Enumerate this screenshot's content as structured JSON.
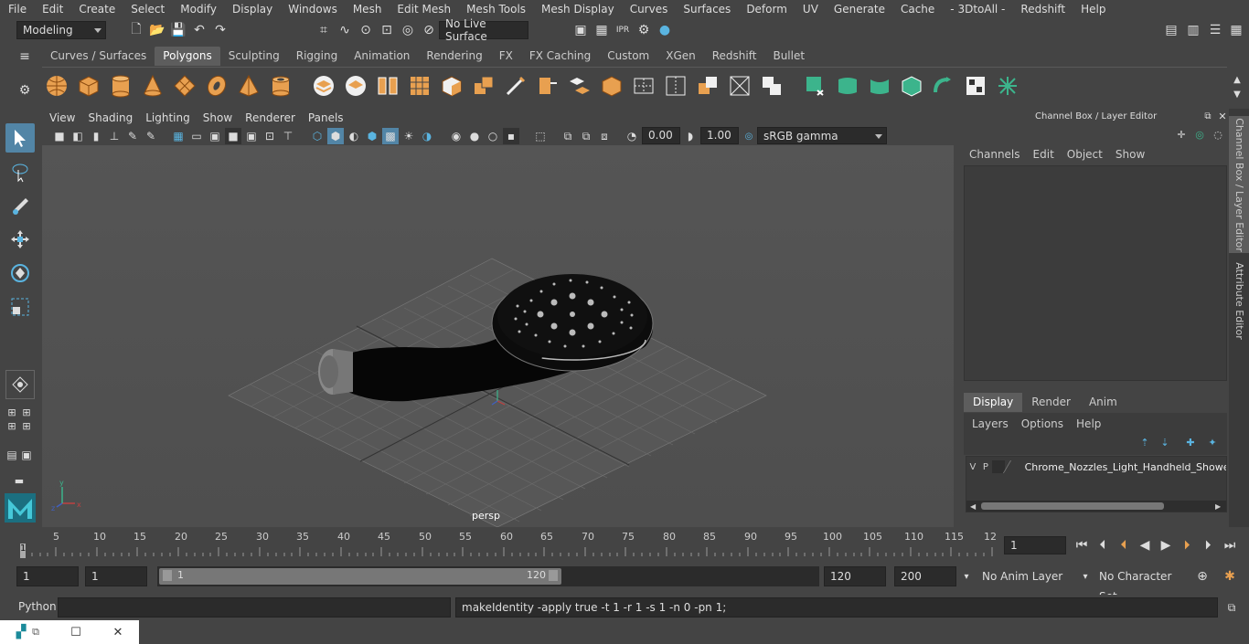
{
  "menubar": [
    "File",
    "Edit",
    "Create",
    "Select",
    "Modify",
    "Display",
    "Windows",
    "Mesh",
    "Edit Mesh",
    "Mesh Tools",
    "Mesh Display",
    "Curves",
    "Surfaces",
    "Deform",
    "UV",
    "Generate",
    "Cache",
    "- 3DtoAll -",
    "Redshift",
    "Help"
  ],
  "mode_dropdown": "Modeling",
  "live_surface": "No Live Surface",
  "shelf_tabs": [
    "Curves / Surfaces",
    "Polygons",
    "Sculpting",
    "Rigging",
    "Animation",
    "Rendering",
    "FX",
    "FX Caching",
    "Custom",
    "XGen",
    "Redshift",
    "Bullet"
  ],
  "shelf_active": "Polygons",
  "panel_menu": [
    "View",
    "Shading",
    "Lighting",
    "Show",
    "Renderer",
    "Panels"
  ],
  "panel_fields": {
    "exposure": "0.00",
    "gamma": "1.00",
    "colorspace": "sRGB gamma"
  },
  "viewport": {
    "camera_label": "persp"
  },
  "channel_box": {
    "title": "Channel Box / Layer Editor",
    "menu": [
      "Channels",
      "Edit",
      "Object",
      "Show"
    ]
  },
  "layer_tabs": [
    "Display",
    "Render",
    "Anim"
  ],
  "layer_active": "Display",
  "layer_menu": [
    "Layers",
    "Options",
    "Help"
  ],
  "layer_row": {
    "v": "V",
    "p": "P",
    "name": "Chrome_Nozzles_Light_Handheld_Shower_H"
  },
  "side_tabs": [
    "Channel Box / Layer Editor",
    "Attribute Editor"
  ],
  "timeline": {
    "ticks": [
      "5",
      "10",
      "15",
      "20",
      "25",
      "30",
      "35",
      "40",
      "45",
      "50",
      "55",
      "60",
      "65",
      "70",
      "75",
      "80",
      "85",
      "90",
      "95",
      "100",
      "105",
      "110",
      "115",
      "12"
    ],
    "start": "1",
    "current": "1"
  },
  "range": {
    "start": "1",
    "playback_start": "1",
    "slider_start": "1",
    "slider_end": "120",
    "end": "120",
    "anim_end": "200",
    "anim_layer": "No Anim Layer",
    "char_set": "No Character Set"
  },
  "cmd": {
    "lang": "Python",
    "output": "makeIdentity -apply true -t 1 -r 1 -s 1 -n 0 -pn 1;"
  },
  "colors": {
    "bg": "#444444",
    "viewport": "#525252",
    "accent": "#5285a6",
    "shelf_orange": "#e8a050",
    "shelf_green": "#3cb48c"
  }
}
